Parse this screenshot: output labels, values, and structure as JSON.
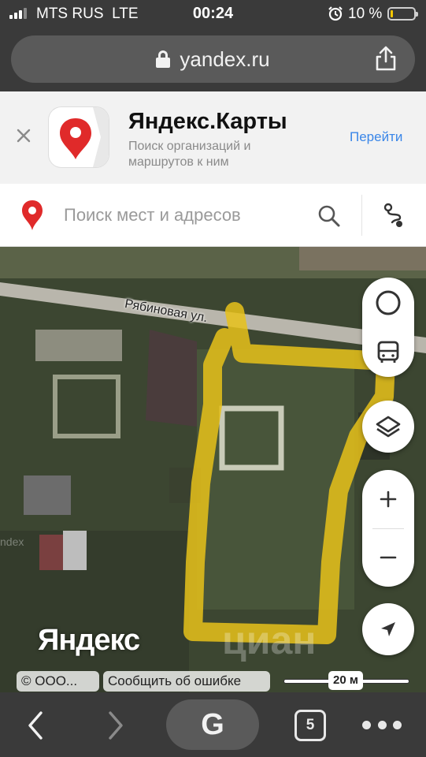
{
  "status_bar": {
    "carrier": "MTS RUS",
    "network": "LTE",
    "time": "00:24",
    "battery_percent": "10 %",
    "battery_level": 0.1,
    "icons": [
      "signal-icon",
      "alarm-icon",
      "battery-icon"
    ]
  },
  "browser": {
    "url": "yandex.ru",
    "icons": [
      "lock-icon",
      "share-icon"
    ]
  },
  "app_banner": {
    "title": "Яндекс.Карты",
    "subtitle": "Поиск организаций и маршрутов к ним",
    "action": "Перейти",
    "icons": [
      "close-icon",
      "yandex-maps-app-icon"
    ]
  },
  "search": {
    "placeholder": "Поиск мест и адресов",
    "icons": [
      "yandex-pin-icon",
      "search-icon",
      "route-icon"
    ]
  },
  "map": {
    "street_label": "Рябиновая ул.",
    "watermark": "Яндекс",
    "faint_text": "ndex",
    "cian_watermark": "циан",
    "controls": [
      "traffic-icon",
      "bus-icon",
      "layers-icon",
      "zoom-in-icon",
      "zoom-out-icon",
      "locate-icon"
    ],
    "copyright": "© ООО...",
    "report_error": "Сообщить об ошибке",
    "scale": "20 м",
    "colors": {
      "highlight": "#e8c21a",
      "accent": "#3a86e8",
      "pin_red": "#e02a2a"
    }
  },
  "toolbar": {
    "tabs_count": "5",
    "google_label": "G",
    "icons": [
      "back-icon",
      "forward-icon",
      "google-icon",
      "tabs-icon",
      "more-icon"
    ]
  }
}
